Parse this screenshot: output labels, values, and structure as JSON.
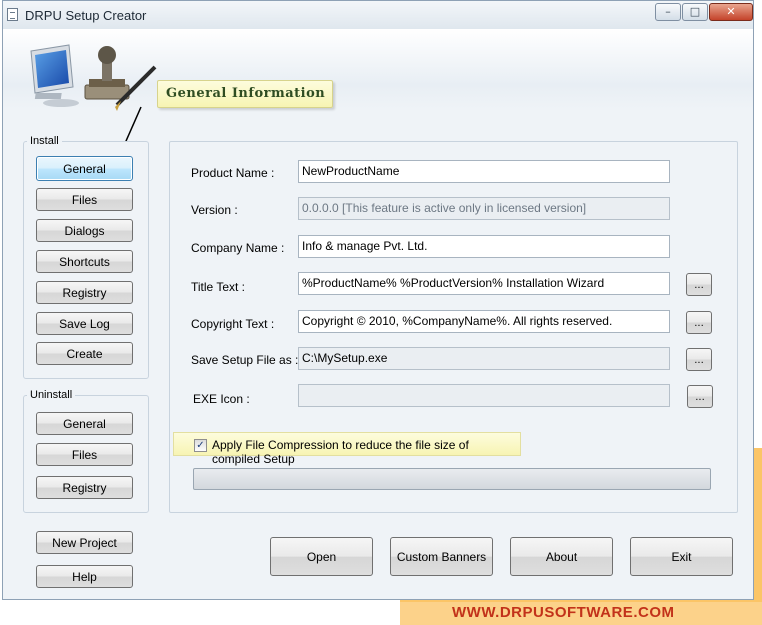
{
  "window": {
    "title": "DRPU Setup Creator",
    "controls": {
      "minimize": "–",
      "maximize": "□",
      "close": "✕"
    }
  },
  "header": {
    "section_title": "General Information"
  },
  "install": {
    "label": "Install",
    "buttons": [
      "General",
      "Files",
      "Dialogs",
      "Shortcuts",
      "Registry",
      "Save Log",
      "Create"
    ]
  },
  "uninstall": {
    "label": "Uninstall",
    "buttons": [
      "General",
      "Files",
      "Registry"
    ]
  },
  "bottom_left": {
    "new_project": "New Project",
    "help": "Help"
  },
  "form": {
    "product_name": {
      "label": "Product Name :",
      "value": "NewProductName"
    },
    "version": {
      "label": "Version :",
      "value": "0.0.0.0 [This feature is active only in licensed version]"
    },
    "company_name": {
      "label": "Company Name :",
      "value": "Info & manage Pvt. Ltd."
    },
    "title_text": {
      "label": "Title Text :",
      "value": "%ProductName% %ProductVersion% Installation Wizard"
    },
    "copyright_text": {
      "label": "Copyright Text :",
      "value": "Copyright © 2010, %CompanyName%. All rights reserved."
    },
    "save_setup": {
      "label": "Save Setup File as :",
      "value": "C:\\MySetup.exe"
    },
    "exe_icon": {
      "label": "EXE Icon :",
      "value": ""
    },
    "browse_label": "...",
    "compression": {
      "checked": true,
      "label": "Apply File Compression to reduce the file size of compiled Setup"
    },
    "progress": 0
  },
  "actions": {
    "open": "Open",
    "custom_banners": "Custom Banners",
    "about": "About",
    "exit": "Exit"
  },
  "footer": {
    "website": "WWW.DRPUSOFTWARE.COM"
  },
  "colors": {
    "accent_orange": "#fbc567",
    "website_red": "#c2321a",
    "banner_yellow": "#f7f4b3"
  }
}
